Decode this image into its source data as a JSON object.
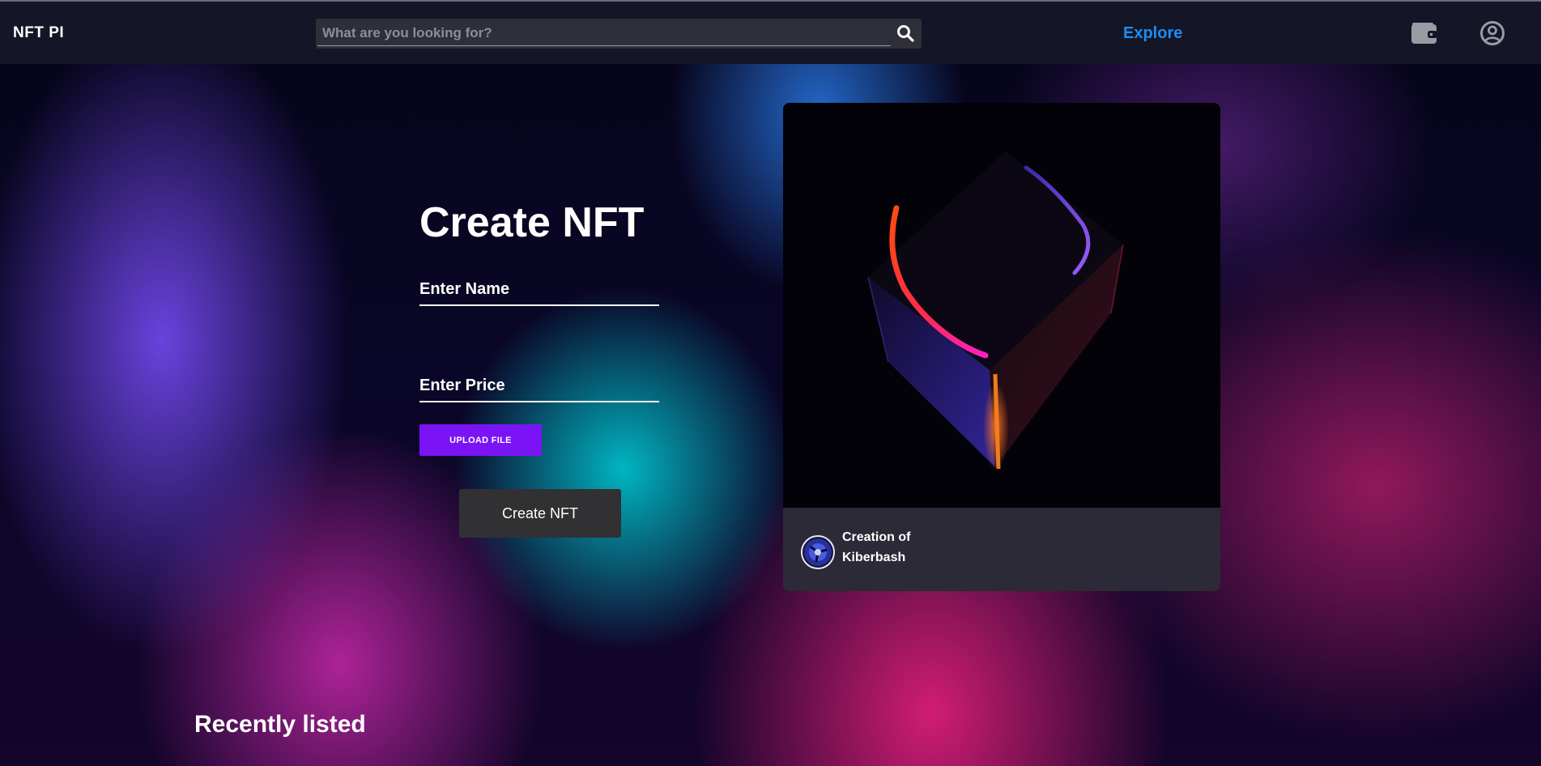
{
  "navbar": {
    "brand": "NFT PI",
    "search_placeholder": "What are you looking for?",
    "search_icon": "search-icon",
    "explore_label": "Explore",
    "wallet_icon": "wallet-icon",
    "profile_icon": "user-circle-icon"
  },
  "form": {
    "title": "Create NFT",
    "name_placeholder": "Enter Name",
    "price_placeholder": "Enter Price",
    "upload_label": "UPLOAD FILE",
    "submit_label": "Create NFT"
  },
  "preview_card": {
    "title": "Creation of Kiberbash",
    "image": "neon-cube-artwork",
    "avatar": "creator-avatar"
  },
  "sections": {
    "recently_listed": "Recently listed"
  },
  "colors": {
    "navbar": "#141526",
    "accent_link": "#1f8bf0",
    "upload_button": "#7a14f5",
    "create_button": "#313133",
    "card": "#2b2a36"
  }
}
